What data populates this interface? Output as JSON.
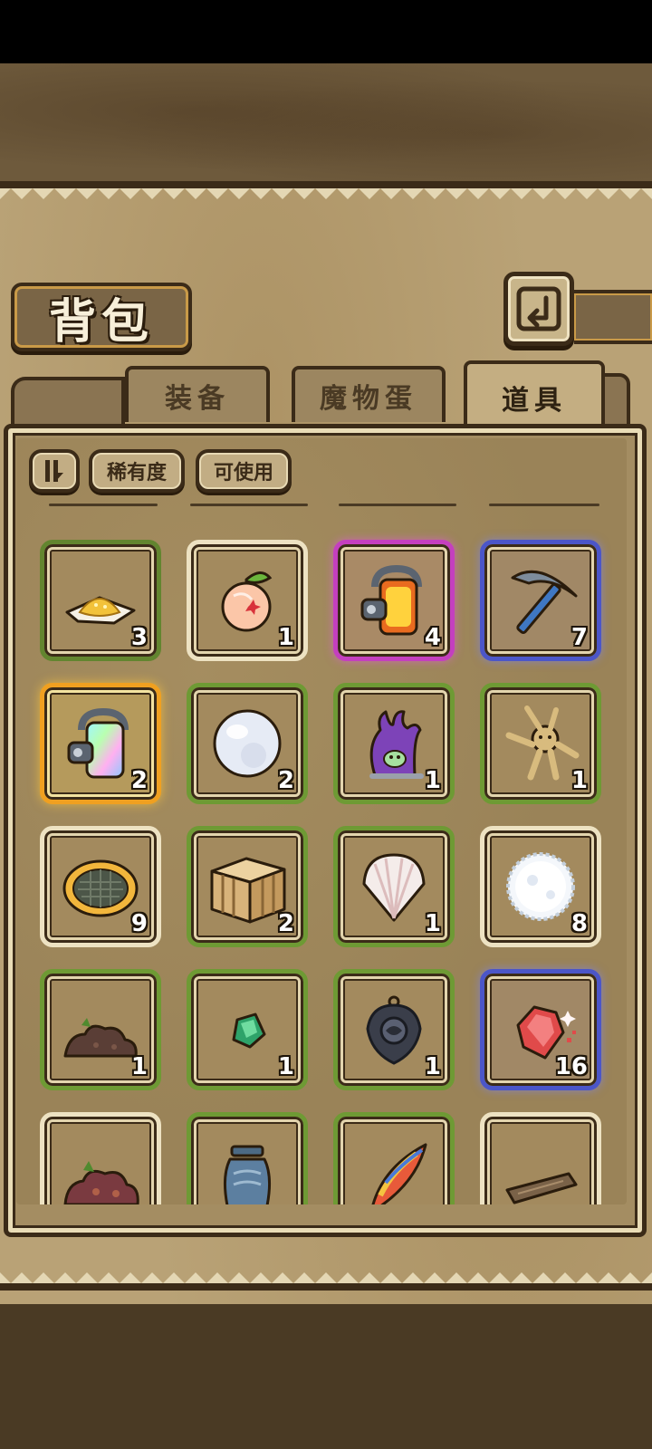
{
  "header": {
    "title": "背包"
  },
  "tabs": [
    {
      "label": "装备",
      "active": false
    },
    {
      "label": "魔物蛋",
      "active": false
    },
    {
      "label": "道具",
      "active": true
    }
  ],
  "filters": {
    "sort_icon": "sort-order-icon",
    "rarity": "稀有度",
    "usable": "可使用"
  },
  "items": [
    {
      "icon": "salt-pile-icon",
      "rarity": "green",
      "qty": "3"
    },
    {
      "icon": "peach-icon",
      "rarity": "white",
      "qty": "1"
    },
    {
      "icon": "orange-capsule-icon",
      "rarity": "purple",
      "qty": "4"
    },
    {
      "icon": "pickaxe-icon",
      "rarity": "blue",
      "qty": "7"
    },
    {
      "icon": "rainbow-capsule-icon",
      "rarity": "gold",
      "qty": "2"
    },
    {
      "icon": "pearl-icon",
      "rarity": "green",
      "qty": "2"
    },
    {
      "icon": "purple-tentacle-monster-icon",
      "rarity": "green",
      "qty": "1"
    },
    {
      "icon": "straw-doll-icon",
      "rarity": "green",
      "qty": "1"
    },
    {
      "icon": "pie-icon",
      "rarity": "white",
      "qty": "9"
    },
    {
      "icon": "wooden-crate-icon",
      "rarity": "green",
      "qty": "2"
    },
    {
      "icon": "seashell-icon",
      "rarity": "green",
      "qty": "1"
    },
    {
      "icon": "snowball-icon",
      "rarity": "white",
      "qty": "8"
    },
    {
      "icon": "soil-pile-icon",
      "rarity": "green",
      "qty": "1"
    },
    {
      "icon": "emerald-icon",
      "rarity": "green",
      "qty": "1"
    },
    {
      "icon": "dark-amulet-icon",
      "rarity": "green",
      "qty": "1"
    },
    {
      "icon": "red-crystal-icon",
      "rarity": "blue",
      "qty": "16"
    },
    {
      "icon": "red-soil-pile-icon",
      "rarity": "white",
      "qty": ""
    },
    {
      "icon": "stone-jar-icon",
      "rarity": "green",
      "qty": ""
    },
    {
      "icon": "rainbow-feather-icon",
      "rarity": "green",
      "qty": ""
    },
    {
      "icon": "wooden-plank-icon",
      "rarity": "white",
      "qty": ""
    }
  ]
}
